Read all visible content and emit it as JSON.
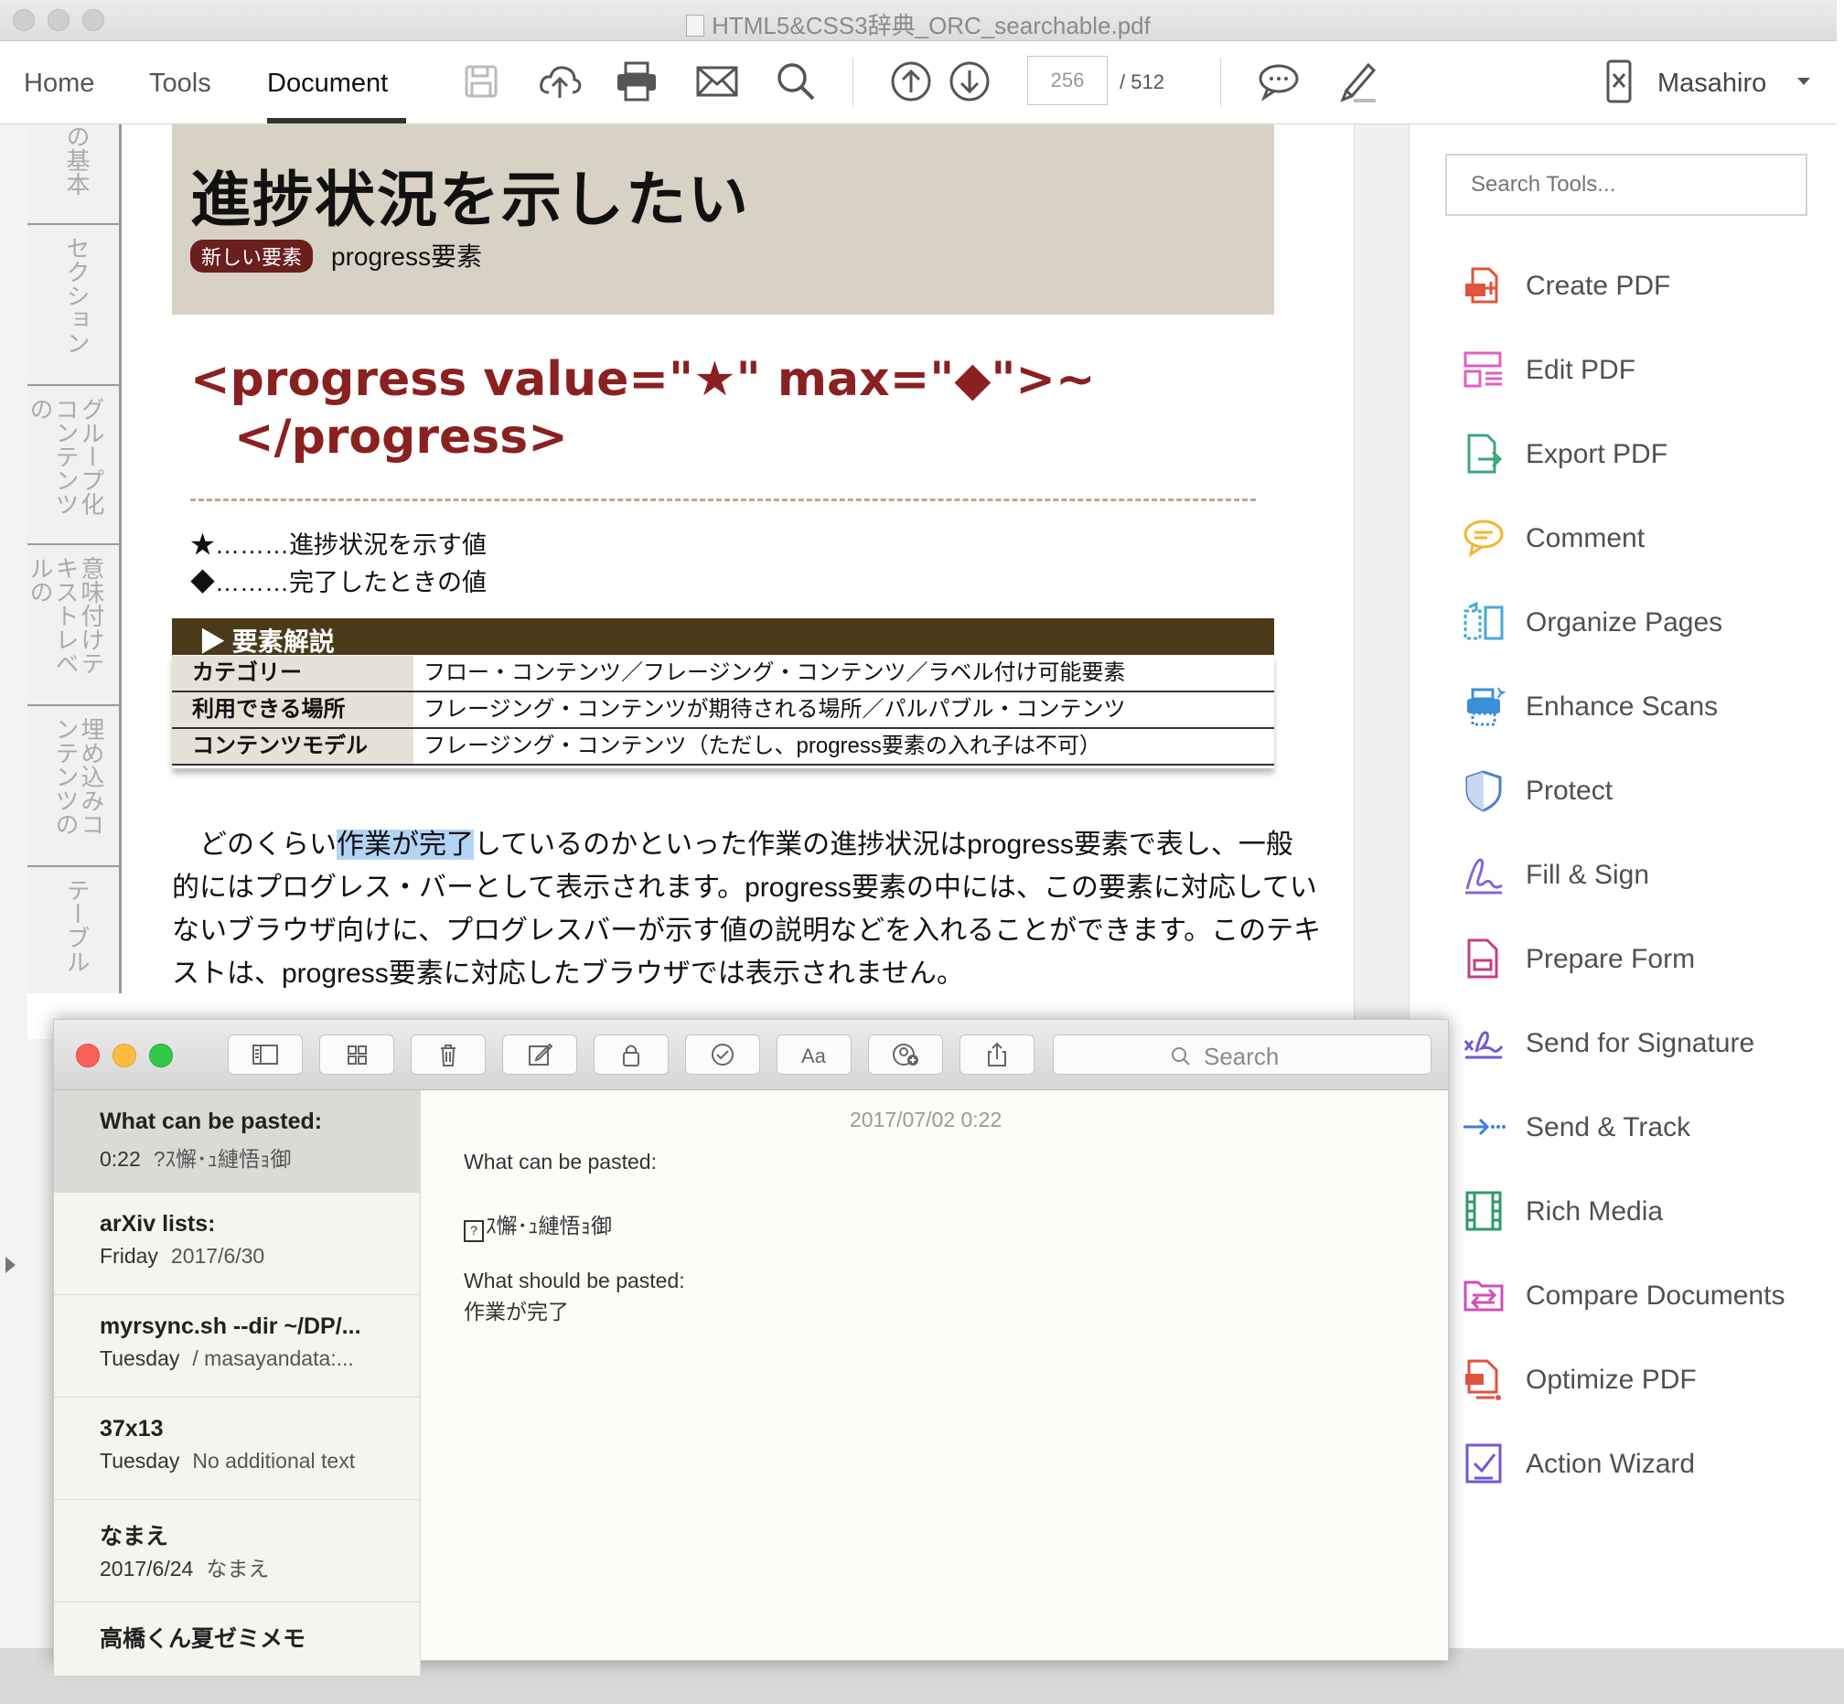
{
  "acrobat": {
    "window_title": "HTML5&CSS3辞典_ORC_searchable.pdf",
    "nav_tabs": [
      {
        "label": "Home"
      },
      {
        "label": "Tools"
      },
      {
        "label": "Document"
      }
    ],
    "page_current": "256",
    "page_total": "/ 512",
    "user_name": "Masahiro",
    "toolbar_icons": [
      "save-icon",
      "upload-cloud-icon",
      "print-icon",
      "email-icon",
      "search-icon",
      "page-up-icon",
      "page-down-icon",
      "comment-icon",
      "highlight-pen-icon",
      "mobile-link-icon"
    ]
  },
  "document_page": {
    "side_index": [
      "の基本",
      "セクション",
      "グループ化コンテンツの",
      "意味付けテキストレベルの",
      "埋め込みコンテンツの",
      "テーブル"
    ],
    "heading": "進捗状況を示したい",
    "badge": "新しい要素",
    "subtitle": "progress要素",
    "syntax_line1": "<progress value=\"★\" max=\"◆\">~",
    "syntax_line2": "</progress>",
    "legend": [
      "★………進捗状況を示す値",
      "◆………完了したときの値"
    ],
    "table_title": "▶ 要素解説",
    "table_rows": [
      {
        "key": "カテゴリー",
        "value": "フロー・コンテンツ／フレージング・コンテンツ／ラベル付け可能要素"
      },
      {
        "key": "利用できる場所",
        "value": "フレージング・コンテンツが期待される場所／パルパブル・コンテンツ"
      },
      {
        "key": "コンテンツモデル",
        "value": "フレージング・コンテンツ（ただし、progress要素の入れ子は不可）"
      }
    ],
    "body": {
      "line1_pre": "　どのくらい",
      "line1_highlight": "作業が完了",
      "line1_post": "しているのかといった作業の進捗状況はprogress要素で表し、一般",
      "line2": "的にはプログレス・バーとして表示されます。progress要素の中には、この要素に対応してい",
      "line3": "ないブラウザ向けに、プログレスバーが示す値の説明などを入れることができます。このテキ",
      "line4": "ストは、progress要素に対応したブラウザでは表示されません。"
    }
  },
  "tools_pane": {
    "search_placeholder": "Search Tools...",
    "tools": [
      {
        "label": "Create PDF",
        "icon": "create-pdf-icon",
        "color": "#e0533d"
      },
      {
        "label": "Edit PDF",
        "icon": "edit-pdf-icon",
        "color": "#e05fc1"
      },
      {
        "label": "Export PDF",
        "icon": "export-pdf-icon",
        "color": "#3aa87a"
      },
      {
        "label": "Comment",
        "icon": "comment-icon",
        "color": "#f0b730"
      },
      {
        "label": "Organize Pages",
        "icon": "organize-pages-icon",
        "color": "#49a8d8"
      },
      {
        "label": "Enhance Scans",
        "icon": "enhance-scans-icon",
        "color": "#3b8fd8"
      },
      {
        "label": "Protect",
        "icon": "shield-icon",
        "color": "#4b7fd0"
      },
      {
        "label": "Fill & Sign",
        "icon": "fill-sign-icon",
        "color": "#7a6ad8"
      },
      {
        "label": "Prepare Form",
        "icon": "prepare-form-icon",
        "color": "#c23f8a"
      },
      {
        "label": "Send for Signature",
        "icon": "send-signature-icon",
        "color": "#6a5ad8"
      },
      {
        "label": "Send & Track",
        "icon": "send-track-icon",
        "color": "#3b7fd8"
      },
      {
        "label": "Rich Media",
        "icon": "rich-media-icon",
        "color": "#2f9a6a"
      },
      {
        "label": "Compare Documents",
        "icon": "compare-documents-icon",
        "color": "#d04fb8"
      },
      {
        "label": "Optimize PDF",
        "icon": "optimize-pdf-icon",
        "color": "#e0533d"
      },
      {
        "label": "Action Wizard",
        "icon": "action-wizard-icon",
        "color": "#6a5ad8"
      }
    ]
  },
  "notes": {
    "search_label": "Search",
    "list": [
      {
        "title": "What can be pasted:",
        "date": "0:22",
        "preview": "?ｽ懈･ｭ縺悟ｮ御"
      },
      {
        "title": "arXiv lists:",
        "date": "Friday",
        "preview": "2017/6/30"
      },
      {
        "title": "myrsync.sh --dir ~/DP/...",
        "date": "Tuesday",
        "preview": "/ masayandata:..."
      },
      {
        "title": "37x13",
        "date": "Tuesday",
        "preview": "No additional text"
      },
      {
        "title": "なまえ",
        "date": "2017/6/24",
        "preview": "なまえ"
      },
      {
        "title": "高橋くん夏ゼミメモ",
        "date": "",
        "preview": ""
      }
    ],
    "editor": {
      "date": "2017/07/02 0:22",
      "line1": "What can be pasted:",
      "line2": "ｽ懈･ｭ縺悟ｮ御",
      "line3": "What should be pasted:",
      "line4": "作業が完了"
    }
  }
}
